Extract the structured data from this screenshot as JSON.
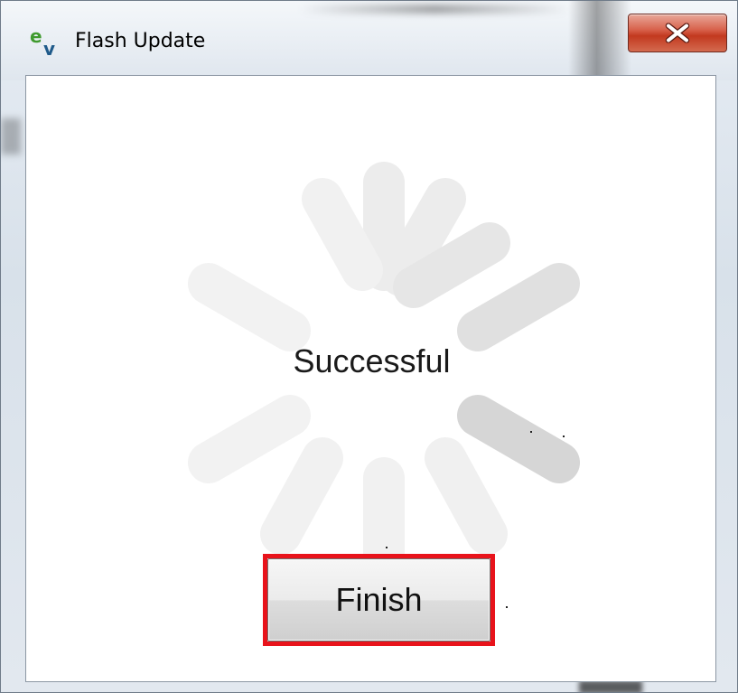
{
  "window": {
    "title": "Flash Update",
    "app_icon": {
      "name": "ev-app-icon",
      "letters": "ev",
      "colors": {
        "e": "#3f9a2e",
        "v": "#1f5a8a"
      }
    }
  },
  "titlebar": {
    "close_icon": "close-icon",
    "close_color": "#c2391f"
  },
  "content": {
    "status": "Successful",
    "spinner_icon": "loading-spinner-icon"
  },
  "actions": {
    "finish_label": "Finish"
  },
  "colors": {
    "highlight": "#e8131b",
    "spinner_light": "#efefef",
    "spinner_dark": "#d6d6d6"
  }
}
